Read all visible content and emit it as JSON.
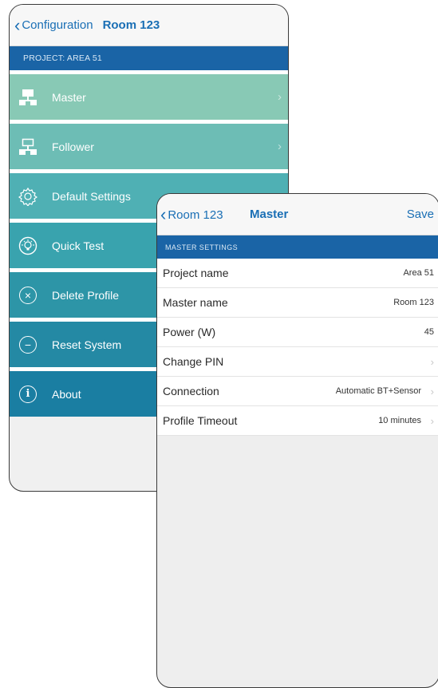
{
  "back_screen": {
    "nav": {
      "back_label": "Configuration",
      "title": "Room 123"
    },
    "project_bar": "PROJECT: AREA 51",
    "menu": [
      {
        "label": "Master",
        "icon": "network-master-icon"
      },
      {
        "label": "Follower",
        "icon": "network-follower-icon"
      },
      {
        "label": "Default Settings",
        "icon": "gear-icon"
      },
      {
        "label": "Quick Test",
        "icon": "lightbulb-icon"
      },
      {
        "label": "Delete Profile",
        "icon": "x-circle-icon"
      },
      {
        "label": "Reset System",
        "icon": "minus-circle-icon"
      },
      {
        "label": "About",
        "icon": "info-icon"
      }
    ]
  },
  "front_screen": {
    "nav": {
      "back_label": "Room 123",
      "title": "Master",
      "save_label": "Save"
    },
    "section_header": "MASTER SETTINGS",
    "rows": [
      {
        "label": "Project name",
        "value": "Area 51"
      },
      {
        "label": "Master name",
        "value": "Room 123"
      },
      {
        "label": "Power (W)",
        "value": "45"
      },
      {
        "label": "Change PIN",
        "value": ""
      },
      {
        "label": "Connection",
        "value": "Automatic BT+Sensor"
      },
      {
        "label": "Profile Timeout",
        "value": "10 minutes"
      }
    ]
  },
  "colors": {
    "accent_blue": "#1a64a6",
    "link_blue": "#1a6fb5",
    "menu_teal_light": "#88c9b5",
    "menu_teal_dark": "#1a7ea2"
  }
}
